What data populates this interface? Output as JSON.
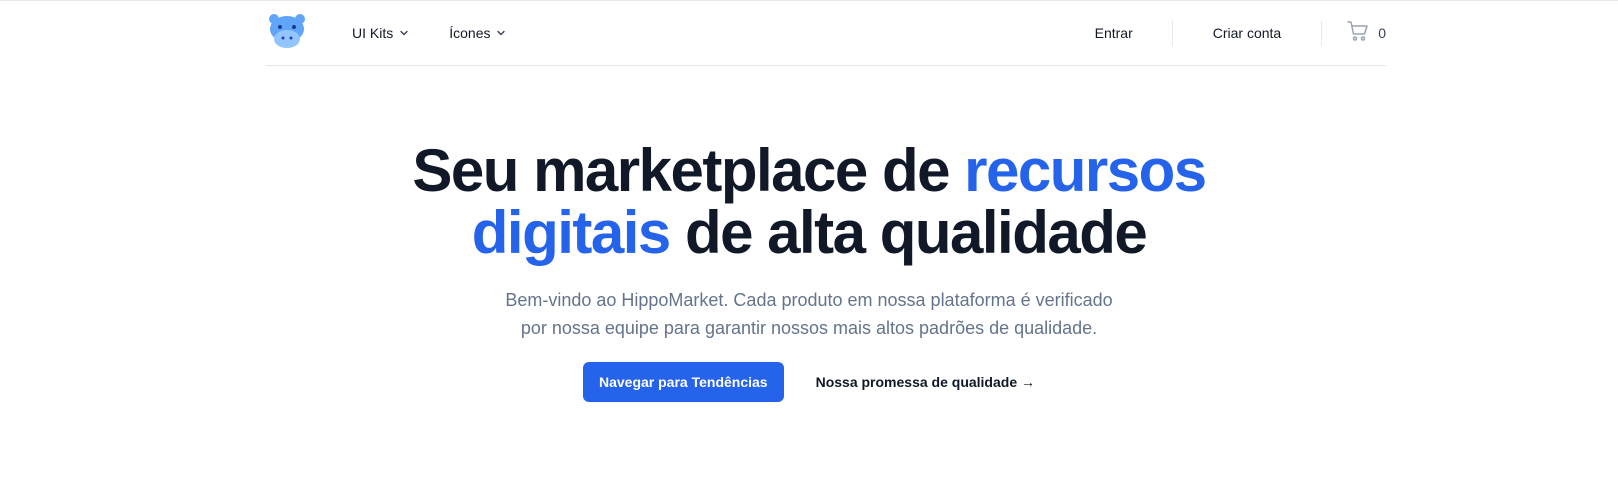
{
  "nav": {
    "logo_icon": "hippo-icon",
    "menus": [
      {
        "label": "UI Kits",
        "icon": "chevron-down-icon"
      },
      {
        "label": "Ícones",
        "icon": "chevron-down-icon"
      }
    ],
    "sign_in": "Entrar",
    "sign_up": "Criar conta",
    "cart_icon": "shopping-cart-icon",
    "cart_count": "0"
  },
  "hero": {
    "title_part1": "Seu marketplace de ",
    "title_accent": "recursos digitais",
    "title_part2": " de alta qualidade",
    "subtitle": "Bem-vindo ao HippoMarket. Cada produto em nossa plataforma é verificado por nossa equipe para garantir nossos mais altos padrões de qualidade.",
    "primary_button": "Navegar para Tendências",
    "secondary_button": "Nossa promessa de qualidade →"
  },
  "colors": {
    "accent": "#2563eb",
    "text": "#111827",
    "muted": "#64748b",
    "border": "#e5e7eb"
  }
}
